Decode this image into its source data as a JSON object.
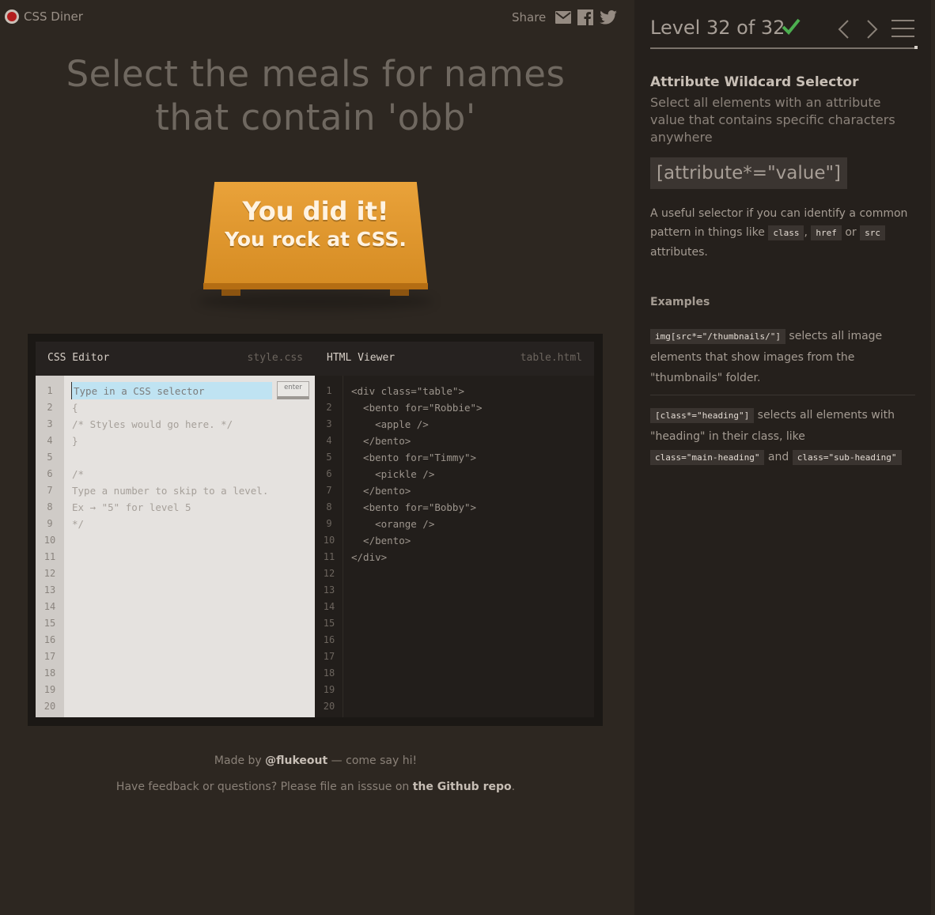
{
  "header": {
    "app_title": "CSS Diner",
    "share_label": "Share",
    "share_icons": [
      "mail-icon",
      "facebook-icon",
      "twitter-icon"
    ]
  },
  "instruction": "Select the meals for names that contain 'obb'",
  "win": {
    "line1": "You did it!",
    "line2": "You rock at CSS."
  },
  "css_editor": {
    "title": "CSS Editor",
    "filename": "style.css",
    "input_placeholder": "Type in a CSS selector",
    "enter_label": "enter",
    "lines": [
      "{",
      "/* Styles would go here. */",
      "}",
      "",
      "/*",
      "Type a number to skip to a level.",
      "Ex → \"5\" for level 5",
      "*/"
    ],
    "line_count": 20
  },
  "html_viewer": {
    "title": "HTML Viewer",
    "filename": "table.html",
    "lines": [
      "<div class=\"table\">",
      "  <bento for=\"Robbie\">",
      "    <apple />",
      "  </bento>",
      "  <bento for=\"Timmy\">",
      "    <pickle />",
      "  </bento>",
      "  <bento for=\"Bobby\">",
      "    <orange />",
      "  </bento>",
      "</div>"
    ],
    "line_count": 20
  },
  "footer": {
    "made_by_prefix": "Made by",
    "made_by_handle": "@flukeout",
    "made_by_suffix": "— come say hi!",
    "feedback_prefix": "Have feedback or questions? Please file an isssue on",
    "feedback_link": "the Github repo",
    "feedback_suffix": "."
  },
  "sidebar": {
    "level_title": "Level 32 of 32",
    "level_complete": true,
    "progress": 1.0,
    "selector_name": "Attribute Wildcard Selector",
    "selector_desc": "Select all elements with an attribute value that contains specific characters anywhere",
    "syntax": "[attribute*=\"value\"]",
    "hint_prefix": "A useful selector if you can identify a common pattern in things like",
    "hint_tag1": "class",
    "hint_sep": ",",
    "hint_tag2": "href",
    "hint_or": "or",
    "hint_tag3": "src",
    "hint_suffix": "attributes.",
    "examples_heading": "Examples",
    "example1_code": "img[src*=\"/thumbnails/\"]",
    "example1_text": "selects all image elements that show images from the \"thumbnails\" folder.",
    "example2_code": "[class*=\"heading\"]",
    "example2_text": "selects all elements with \"heading\" in their class, like",
    "example2_tag1": "class=\"main-heading\"",
    "example2_and": "and",
    "example2_tag2": "class=\"sub-heading\""
  },
  "colors": {
    "background": "#2d2721",
    "sidebar": "#25201c",
    "table": "#e09a30",
    "check": "#4caf50",
    "input_highlight": "#bfe3f2"
  }
}
